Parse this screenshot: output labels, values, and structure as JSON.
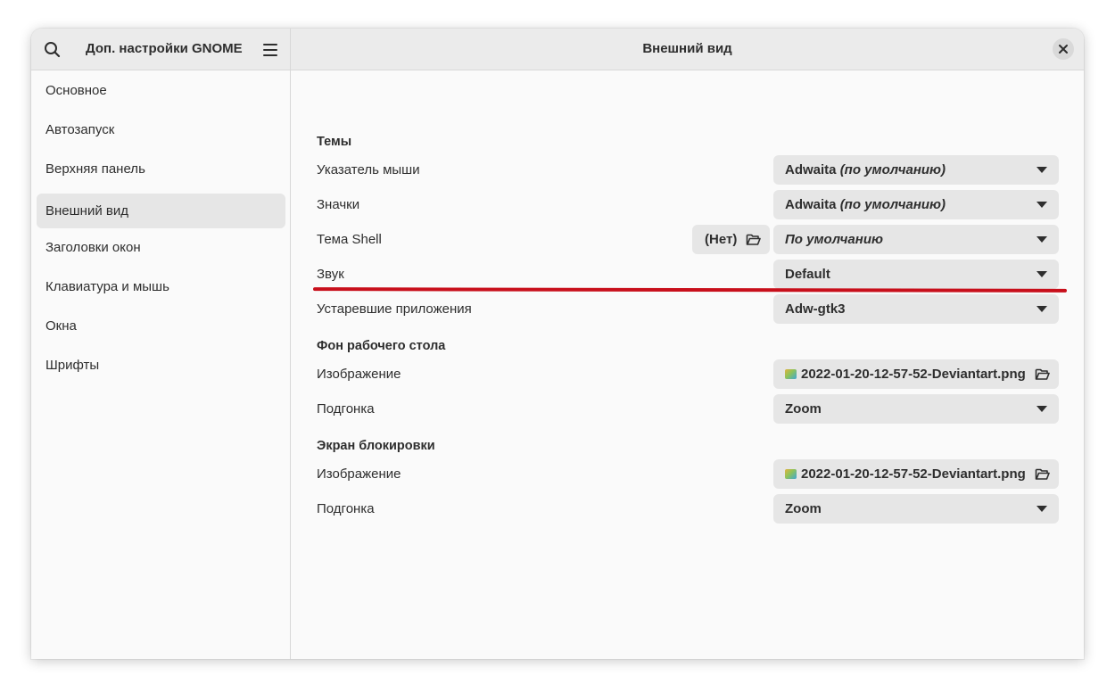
{
  "header": {
    "app_title": "Доп. настройки GNOME",
    "page_title": "Внешний вид",
    "icons": {
      "search": "search-icon",
      "menu": "hamburger-menu-icon",
      "close": "close-icon"
    }
  },
  "sidebar": {
    "items": [
      {
        "label": "Основное",
        "active": false
      },
      {
        "label": "Автозапуск",
        "active": false
      },
      {
        "label": "Верхняя панель",
        "active": false
      },
      {
        "label": "Внешний вид",
        "active": true
      },
      {
        "label": "Заголовки окон",
        "active": false
      },
      {
        "label": "Клавиатура и мышь",
        "active": false
      },
      {
        "label": "Окна",
        "active": false
      },
      {
        "label": "Шрифты",
        "active": false
      }
    ]
  },
  "themes": {
    "title": "Темы",
    "cursor": {
      "label": "Указатель мыши",
      "value": "Adwaita",
      "suffix": "(по умолчанию)"
    },
    "icons": {
      "label": "Значки",
      "value": "Adwaita",
      "suffix": "(по умолчанию)"
    },
    "shell": {
      "label": "Тема Shell",
      "none_button": "(Нет)",
      "value": "По умолчанию"
    },
    "sound": {
      "label": "Звук",
      "value": "Default"
    },
    "legacy": {
      "label": "Устаревшие приложения",
      "value": "Adw-gtk3"
    }
  },
  "background": {
    "title": "Фон рабочего стола",
    "image": {
      "label": "Изображение",
      "value": "2022-01-20-12-57-52-Deviantart.png"
    },
    "adjustment": {
      "label": "Подгонка",
      "value": "Zoom"
    }
  },
  "lock_screen": {
    "title": "Экран блокировки",
    "image": {
      "label": "Изображение",
      "value": "2022-01-20-12-57-52-Deviantart.png"
    },
    "adjustment": {
      "label": "Подгонка",
      "value": "Zoom"
    }
  },
  "colors": {
    "annotation_underline": "#c80f1b",
    "header_bg": "#ebebeb",
    "active_item_bg": "#e6e6e6"
  }
}
